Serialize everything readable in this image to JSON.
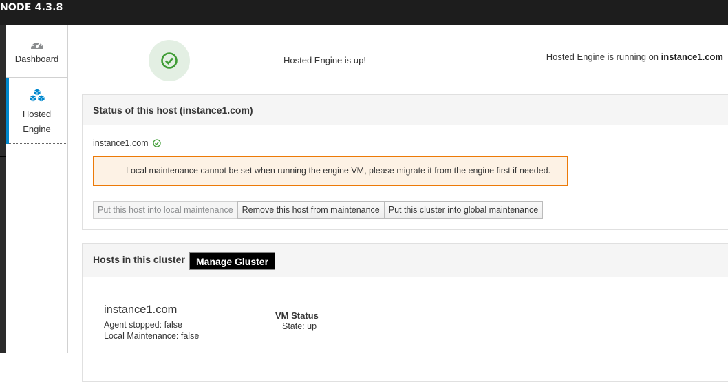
{
  "app": {
    "title": "NODE 4.3.8"
  },
  "sidebar": {
    "items": [
      {
        "label": "Dashboard",
        "icon": "dashboard-icon"
      },
      {
        "label": "Hosted",
        "label2": "Engine",
        "icon": "cubes-icon"
      }
    ]
  },
  "summary": {
    "status_icon": "check-circle-icon",
    "engine_up": "Hosted Engine is up!",
    "running_prefix": "Hosted Engine is running on",
    "running_host": "instance1.com"
  },
  "host_status": {
    "title": "Status of this host (instance1.com)",
    "hostname": "instance1.com",
    "alert": "Local maintenance cannot be set when running the engine VM, please migrate it from the engine first if needed.",
    "buttons": [
      {
        "label": "Put this host into local maintenance",
        "disabled": true
      },
      {
        "label": "Remove this host from maintenance",
        "disabled": false
      },
      {
        "label": "Put this cluster into global maintenance",
        "disabled": false
      }
    ]
  },
  "cluster": {
    "title": "Hosts in this cluster",
    "gluster_button": "Manage Gluster",
    "hosts": [
      {
        "name": "instance1.com",
        "agent_stopped": "Agent stopped: false",
        "local_maintenance": "Local Maintenance: false",
        "vm_status_label": "VM Status",
        "vm_state": "State: up"
      }
    ]
  },
  "colors": {
    "accent": "#0088ce",
    "success": "#3f9c35",
    "warning": "#ec7a08",
    "topbar": "#1d1d1d"
  }
}
